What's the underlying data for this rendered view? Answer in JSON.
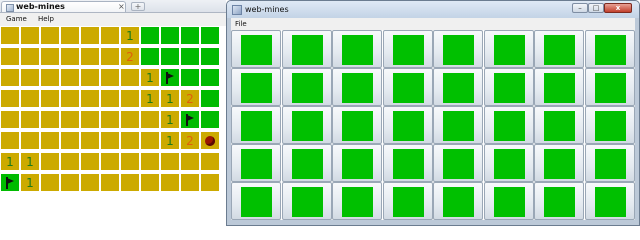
{
  "left_window": {
    "tab_title": "web-mines",
    "tab_close_glyph": "×",
    "new_tab_glyph": "+",
    "menu": [
      "Game",
      "Help"
    ],
    "board": {
      "rows": [
        "HHHHHH1OOOO",
        "HHHHHH2OOOO",
        "HHHHHHH1FOO",
        "HHHHHHH112O",
        "HHHHHHHH1FO",
        "HHHHHHHH12B",
        "11HHHHHHHHH",
        "F1HHHHHHHHH"
      ],
      "legend": {
        "H": "hidden",
        "O": "open",
        "F": "flag",
        "B": "mine",
        "1": "number-1",
        "2": "number-2"
      },
      "colors": {
        "hidden": "#ccaa00",
        "open": "#00bb00",
        "one": "#1c7a17",
        "two": "#e0600a",
        "mine": "#9a1600"
      }
    }
  },
  "right_window": {
    "title": "web-mines",
    "menu": [
      "File"
    ],
    "grid_rows": 5,
    "grid_cols": 8,
    "colors": {
      "square": "#00c000",
      "button_face": "#e4eaf0"
    },
    "window_buttons": {
      "minimize": "–",
      "maximize": "□",
      "close": "x"
    }
  }
}
